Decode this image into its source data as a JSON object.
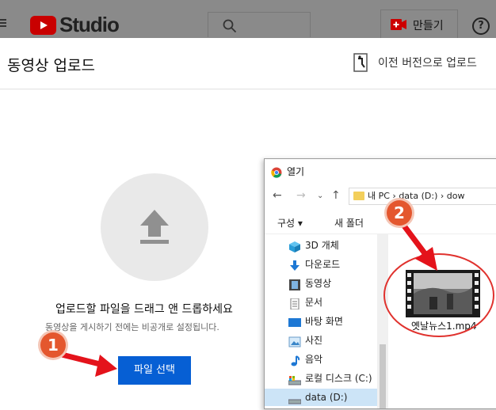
{
  "header": {
    "studio_label": "Studio",
    "create_label": "만들기",
    "help_label": "?"
  },
  "dialog": {
    "title": "동영상 업로드",
    "prev_version_label": "이전 버전으로 업로드",
    "drag_text": "업로드할 파일을 드래그 앤 드롭하세요",
    "sub_text": "동영상을 게시하기 전에는 비공개로 설정됩니다.",
    "select_button_label": "파일 선택"
  },
  "annotations": {
    "badge1": "1",
    "badge2": "2",
    "accent_color": "#e4572e"
  },
  "file_dialog": {
    "title": "열기",
    "address": "내 PC  ›  data (D:)  ›  dow",
    "toolbar": {
      "organize": "구성 ▾",
      "new_folder": "새 폴더"
    },
    "sidebar": [
      {
        "label": "3D 개체",
        "icon": "cube-icon"
      },
      {
        "label": "다운로드",
        "icon": "download-icon"
      },
      {
        "label": "동영상",
        "icon": "video-icon"
      },
      {
        "label": "문서",
        "icon": "document-icon"
      },
      {
        "label": "바탕 화면",
        "icon": "desktop-icon"
      },
      {
        "label": "사진",
        "icon": "picture-icon"
      },
      {
        "label": "음악",
        "icon": "music-icon"
      },
      {
        "label": "로컬 디스크 (C:)",
        "icon": "disk-icon"
      },
      {
        "label": "data (D:)",
        "icon": "drive-icon"
      }
    ],
    "file": {
      "name": "옛날뉴스1.mp4",
      "icon": "video-file-icon"
    }
  },
  "colors": {
    "topbar": "#8a8a8a",
    "primary_button": "#065fd4",
    "youtube_red": "#ff0000",
    "highlight_red": "#e0322e"
  }
}
